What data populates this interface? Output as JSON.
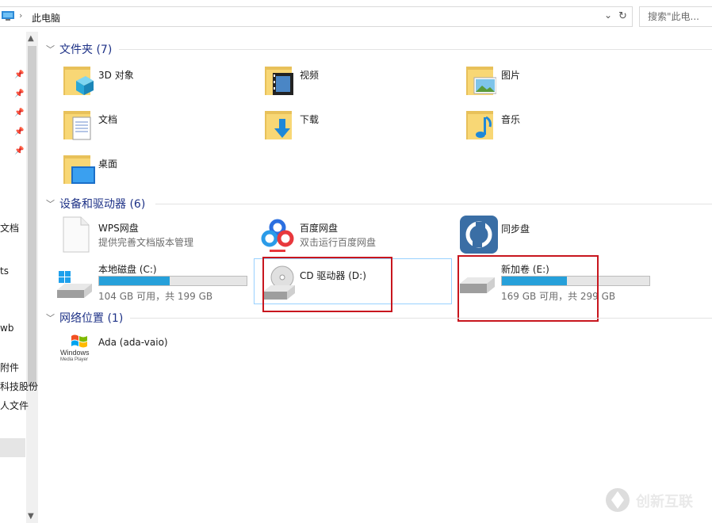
{
  "address": {
    "breadcrumb_location": "此电脑",
    "search_placeholder": "搜索\"此电..."
  },
  "nav_pane": {
    "items": [
      "文档",
      "ts",
      "wb",
      "附件",
      "科技股份",
      "人文件"
    ]
  },
  "groups": {
    "folders": {
      "header": "文件夹 (7)",
      "items": [
        "3D 对象",
        "视频",
        "图片",
        "文档",
        "下载",
        "音乐",
        "桌面"
      ]
    },
    "devices": {
      "header": "设备和驱动器 (6)",
      "wps": {
        "name": "WPS网盘",
        "desc": "提供完善文档版本管理"
      },
      "baidu": {
        "name": "百度网盘",
        "desc": "双击运行百度网盘"
      },
      "sync": {
        "name": "同步盘"
      },
      "drive_c": {
        "name": "本地磁盘 (C:)",
        "space": "104 GB 可用，共 199 GB",
        "used_fraction": 0.48
      },
      "drive_d": {
        "name": "CD 驱动器 (D:)"
      },
      "drive_e": {
        "name": "新加卷 (E:)",
        "space": "169 GB 可用，共 299 GB",
        "used_fraction": 0.44
      }
    },
    "network": {
      "header": "网络位置 (1)",
      "items": [
        "Ada (ada-vaio)"
      ],
      "icon_text": [
        "Windows",
        "Media Player"
      ]
    }
  },
  "watermark": {
    "text": "创新互联"
  },
  "colors": {
    "accent": "#26a0da",
    "header": "#1e3287",
    "highlight_box": "#c8161e",
    "folder": "#f8d775"
  }
}
